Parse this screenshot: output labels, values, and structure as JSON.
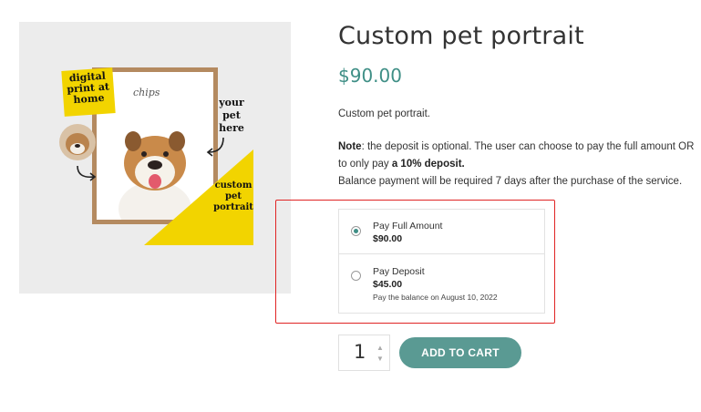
{
  "product": {
    "title": "Custom pet portrait",
    "price": "$90.00",
    "short_description": "Custom pet portrait.",
    "note": {
      "label": "Note",
      "text_1": ": the deposit is optional. The user can choose to pay the full amount OR to only pay ",
      "bold": "a 10% deposit.",
      "text_2": "Balance payment will be required 7 days after the purchase of the service."
    }
  },
  "image": {
    "banner_text": "digital print at home",
    "right_text": "your pet here",
    "triangle_text": "custom pet portrait",
    "signature": "chips"
  },
  "options": [
    {
      "label": "Pay Full Amount",
      "price": "$90.00",
      "selected": true
    },
    {
      "label": "Pay Deposit",
      "price": "$45.00",
      "note": "Pay the balance on August 10, 2022",
      "selected": false
    }
  ],
  "cart": {
    "quantity": "1",
    "add_to_cart_label": "ADD TO CART"
  },
  "colors": {
    "accent": "#3f8f86",
    "button": "#5a9a93",
    "highlight": "#e02424",
    "yellow": "#f2d400"
  }
}
